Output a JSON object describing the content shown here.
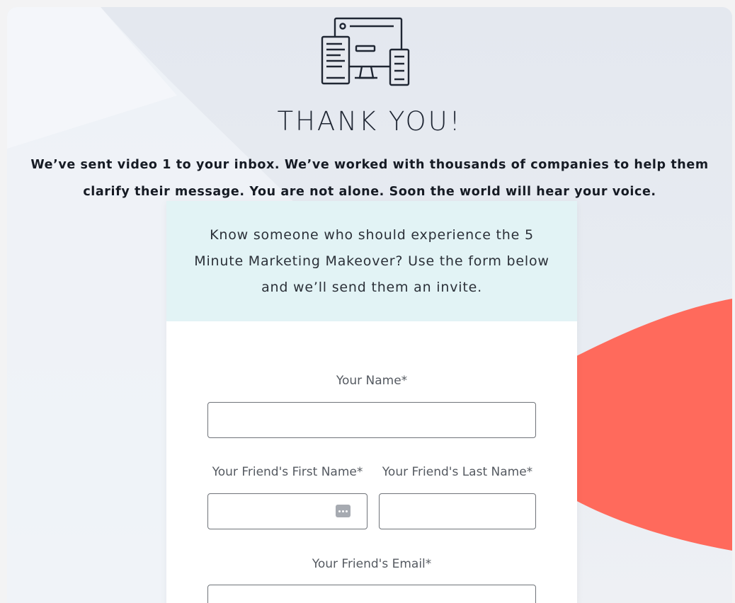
{
  "page": {
    "title": "THANK YOU!",
    "message": "We’ve sent video 1 to your inbox. We’ve worked with thousands of companies to help them clarify their message. You are not alone. Soon the world will hear your voice.",
    "hero_icon": "devices-icon"
  },
  "referral": {
    "intro": "Know someone who should experience the 5 Minute Marketing Makeover? Use the form below and we’ll send them an invite.",
    "fields": {
      "your_name": {
        "label": "Your Name*",
        "value": ""
      },
      "friend_first_name": {
        "label": "Your Friend's First Name*",
        "value": ""
      },
      "friend_last_name": {
        "label": "Your Friend's Last Name*",
        "value": ""
      },
      "friend_email": {
        "label": "Your Friend's Email*",
        "value": ""
      }
    }
  },
  "colors": {
    "accent_coral": "#ff6a5c",
    "header_tint": "#e2f3f5",
    "text_dark": "#1f2633"
  }
}
